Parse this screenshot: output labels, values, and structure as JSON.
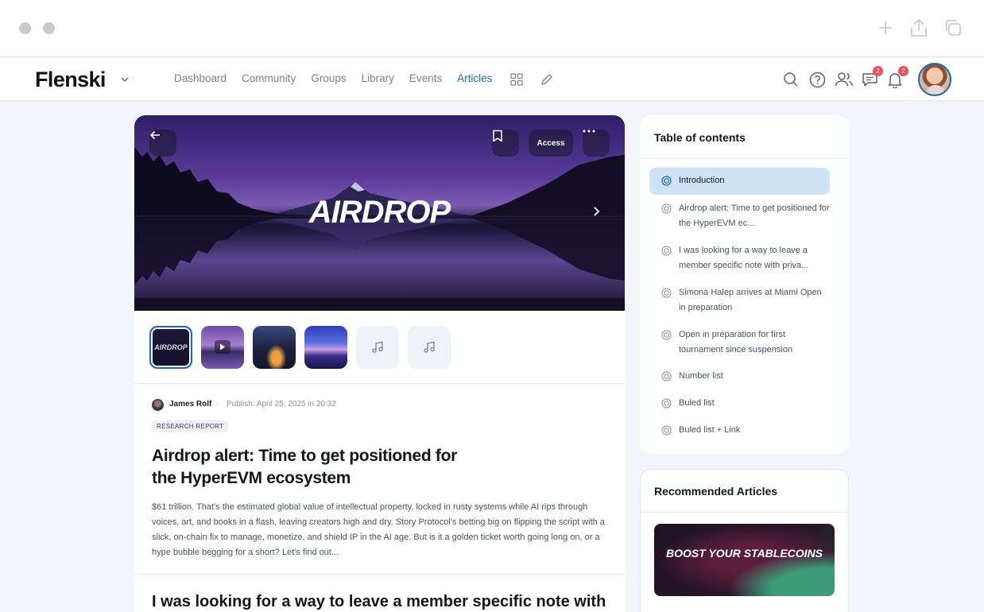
{
  "chrome": {
    "window_dots": [
      "close",
      "minimize"
    ],
    "icons": [
      "plus-icon",
      "share-icon",
      "duplicate-icon"
    ]
  },
  "nav": {
    "logo": "Flenski",
    "links": [
      {
        "label": "Dashboard",
        "active": false
      },
      {
        "label": "Community",
        "active": false
      },
      {
        "label": "Groups",
        "active": false
      },
      {
        "label": "Library",
        "active": false
      },
      {
        "label": "Events",
        "active": false
      },
      {
        "label": "Articles",
        "active": true
      }
    ],
    "messages_badge": "2",
    "notifications_badge": "2",
    "accent_color": "#1967c4"
  },
  "hero": {
    "title": "AIRDROP",
    "access_label": "Access"
  },
  "thumbnails": [
    {
      "kind": "image",
      "label": "AIRDROP",
      "selected": true
    },
    {
      "kind": "video",
      "label": "",
      "selected": false
    },
    {
      "kind": "image",
      "label": "",
      "selected": false
    },
    {
      "kind": "image",
      "label": "",
      "selected": false
    },
    {
      "kind": "audio",
      "label": "",
      "selected": false
    },
    {
      "kind": "audio",
      "label": "",
      "selected": false
    }
  ],
  "article": {
    "author": "James Rolf",
    "publish": "Publish: April 25, 2025 in 20:32",
    "tag": "RESEARCH REPORT",
    "headline": "Airdrop alert: Time to get positioned for the HyperEVM ecosystem",
    "body": "$61 trillion. That's the estimated global value of intellectual property, locked in rusty systems while AI rips through voices, art, and books in a flash, leaving creators high and dry. Story Protocol's betting big on flipping the script with a slick, on-chain fix to manage, monetize, and shield IP in the AI age. But is it a golden ticket worth going long on, or a hype bubble begging for a short? Let's find out...",
    "next_headline": "I was looking for a way to leave a member specific note with"
  },
  "toc": {
    "title": "Table of contents",
    "items": [
      {
        "label": "Introduction",
        "active": true
      },
      {
        "label": "Airdrop alert: Time to get positioned for the HyperEVM ec...",
        "active": false
      },
      {
        "label": "I was looking for a way to leave a member specific note with priva...",
        "active": false
      },
      {
        "label": "Simona Halep arrives at Miami Open in preparation",
        "active": false
      },
      {
        "label": "Open in preparation for first tournament since suspension",
        "active": false
      },
      {
        "label": "Number list",
        "active": false
      },
      {
        "label": "Buled list",
        "active": false
      },
      {
        "label": "Buled list + Link",
        "active": false
      }
    ]
  },
  "recommended": {
    "title": "Recommended Articles",
    "card_text": "BOOST YOUR STABLECOINS"
  }
}
